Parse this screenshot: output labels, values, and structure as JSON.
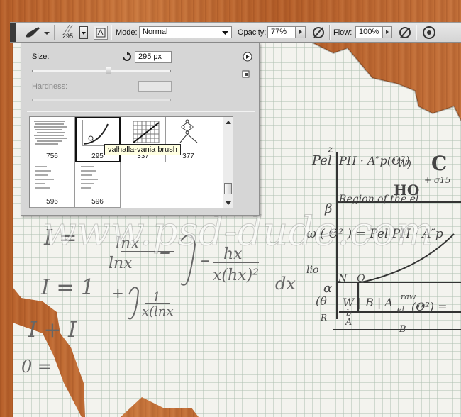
{
  "toolbar": {
    "brush_size": "295",
    "mode_label": "Mode:",
    "mode_value": "Normal",
    "opacity_label": "Opacity:",
    "opacity_value": "77%",
    "flow_label": "Flow:",
    "flow_value": "100%"
  },
  "brush_panel": {
    "size_label": "Size:",
    "size_value": "295 px",
    "hardness_label": "Hardness:",
    "size_fraction": 0.55,
    "presets": [
      {
        "size": "756"
      },
      {
        "size": "295",
        "selected": true
      },
      {
        "size": "337"
      },
      {
        "size": "377"
      },
      {
        "size": "596"
      },
      {
        "size": "596"
      }
    ],
    "tooltip": "valhalla-vania brush"
  },
  "canvas": {
    "watermark": "www.psd-dude.com",
    "math": {
      "formula_i_eq": "I =",
      "frac_num": "lnx",
      "frac_den": "lnx",
      "minus": "–",
      "integral": "∫",
      "dash": "–",
      "hx": "hx",
      "denominator": "x(hx)²",
      "dx": "dx",
      "i_eq_1": "I = 1",
      "plus": "+",
      "integral2": "∫",
      "frac2_num": "1",
      "frac2_den": "x(lnx",
      "i_plus": "I + I",
      "zero": "0 =",
      "pel": "Pel",
      "ph": "PH · A″p(Θ²)",
      "w": "W)",
      "c": "C",
      "ho": "HO",
      "region": "Region of the el",
      "beta": "β",
      "omega": "ω ( Θ² ) = Pel PH · A″p",
      "lio": "lio",
      "n": "N",
      "q": "Q",
      "alpha": "α",
      "theta": "(θ",
      "wb": "W | B | A",
      "raw": "raw",
      "el": "el",
      "theta2": "(Θ²) =",
      "a_label": "A",
      "b_label": "B",
      "z": "z",
      "plus_t": "+ σ15",
      "b2": "b",
      "r": "R"
    }
  },
  "colors": {
    "toolbar_bg": "#dcdcdc",
    "panel_bg": "#d6d6d6",
    "tooltip_bg": "#ffffe1",
    "paper": "#f4f4f0",
    "grid": "#b9c9b8",
    "wood": "#c06a32"
  }
}
